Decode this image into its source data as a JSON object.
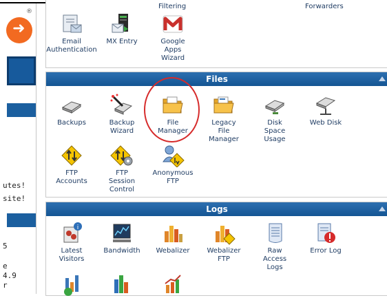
{
  "left_column": {
    "registered_mark": "®",
    "text_lines": [
      "utes!",
      "site!",
      "5",
      "e",
      "4.9",
      "r"
    ]
  },
  "top_section": {
    "header_items": [
      "Filtering",
      "Forwarders"
    ],
    "items": [
      {
        "label": "Email\nAuthentication",
        "icon": "email-auth-icon"
      },
      {
        "label": "MX Entry",
        "icon": "mx-entry-icon"
      },
      {
        "label": "Google\nApps\nWizard",
        "icon": "google-apps-icon"
      }
    ]
  },
  "files_section": {
    "title": "Files",
    "items": [
      {
        "label": "Backups",
        "icon": "backup-icon"
      },
      {
        "label": "Backup\nWizard",
        "icon": "backup-wizard-icon"
      },
      {
        "label": "File\nManager",
        "icon": "folder-icon"
      },
      {
        "label": "Legacy\nFile\nManager",
        "icon": "legacy-folder-icon"
      },
      {
        "label": "Disk\nSpace\nUsage",
        "icon": "disk-space-icon"
      },
      {
        "label": "Web Disk",
        "icon": "web-disk-icon"
      },
      {
        "label": "FTP\nAccounts",
        "icon": "ftp-accounts-icon"
      },
      {
        "label": "FTP\nSession\nControl",
        "icon": "ftp-session-icon"
      },
      {
        "label": "Anonymous\nFTP",
        "icon": "anonymous-ftp-icon"
      }
    ]
  },
  "logs_section": {
    "title": "Logs",
    "items": [
      {
        "label": "Latest\nVisitors",
        "icon": "latest-visitors-icon"
      },
      {
        "label": "Bandwidth",
        "icon": "bandwidth-icon"
      },
      {
        "label": "Webalizer",
        "icon": "webalizer-icon"
      },
      {
        "label": "Webalizer\nFTP",
        "icon": "webalizer-ftp-icon"
      },
      {
        "label": "Raw\nAccess\nLogs",
        "icon": "raw-logs-icon"
      },
      {
        "label": "Error Log",
        "icon": "error-log-icon"
      }
    ]
  },
  "colors": {
    "header_blue": "#145593",
    "label_text": "#1f3c63",
    "highlight": "#d62b2b",
    "logo_orange": "#f26a21"
  }
}
